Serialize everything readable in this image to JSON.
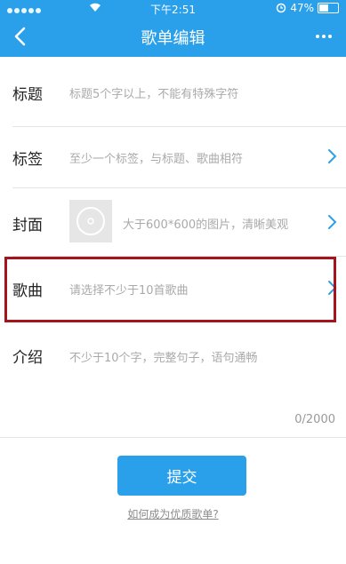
{
  "status_bar": {
    "time": "下午2:51",
    "battery": "47%"
  },
  "nav": {
    "title": "歌单编辑",
    "back_icon": "chevron-left-icon",
    "more_icon": "more-icon"
  },
  "form": {
    "title": {
      "label": "标题",
      "placeholder": "标题5个字以上，不能有特殊字符"
    },
    "tags": {
      "label": "标签",
      "placeholder": "至少一个标签，与标题、歌曲相符"
    },
    "cover": {
      "label": "封面",
      "placeholder": "大于600*600的图片，清晰美观"
    },
    "songs": {
      "label": "歌曲",
      "placeholder": "请选择不少于10首歌曲"
    },
    "intro": {
      "label": "介绍",
      "placeholder": "不少于10个字，完整句子，语句通畅",
      "counter": "0/2000"
    }
  },
  "actions": {
    "submit": "提交",
    "help_link": "如何成为优质歌单?"
  },
  "colors": {
    "primary": "#2aa0ea",
    "highlight_border": "#a4141a"
  }
}
